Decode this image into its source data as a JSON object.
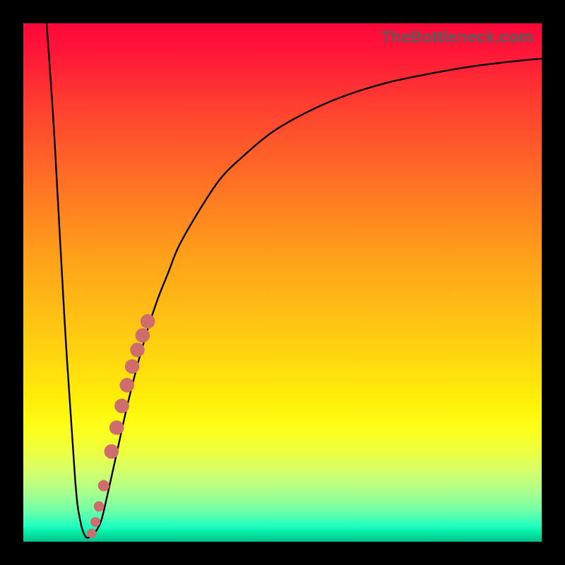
{
  "watermark": "TheBottleneck.com",
  "colors": {
    "frame": "#000000",
    "curve": "#000000",
    "dot_fill": "#cf6d6d",
    "dot_stroke": "#cf6d6d"
  },
  "chart_data": {
    "type": "line",
    "title": "",
    "xlabel": "",
    "ylabel": "",
    "xlim": [
      0,
      100
    ],
    "ylim": [
      0,
      100
    ],
    "grid": false,
    "series": [
      {
        "name": "bottleneck-curve",
        "x": [
          4.5,
          6,
          8,
          10,
          11,
          12,
          13,
          14,
          15,
          16,
          18,
          20,
          22,
          24,
          26,
          28,
          30,
          34,
          38,
          42,
          48,
          55,
          62,
          70,
          78,
          86,
          94,
          100
        ],
        "y": [
          100,
          78,
          42,
          12,
          4,
          1,
          1,
          2,
          4,
          8,
          17,
          26,
          34,
          41,
          47,
          52,
          57,
          64,
          70,
          74,
          79,
          83,
          86,
          88.5,
          90.2,
          91.6,
          92.6,
          93.2
        ]
      }
    ],
    "markers": [
      {
        "name": "band-top",
        "x": 24.0,
        "y": 42.5,
        "r": 1.4
      },
      {
        "name": "band-a",
        "x": 23.0,
        "y": 39.8,
        "r": 1.4
      },
      {
        "name": "band-b",
        "x": 22.0,
        "y": 37.0,
        "r": 1.4
      },
      {
        "name": "band-c",
        "x": 21.0,
        "y": 33.8,
        "r": 1.4
      },
      {
        "name": "band-d",
        "x": 20.0,
        "y": 30.2,
        "r": 1.4
      },
      {
        "name": "band-e",
        "x": 19.0,
        "y": 26.2,
        "r": 1.4
      },
      {
        "name": "band-f",
        "x": 18.0,
        "y": 22.0,
        "r": 1.4
      },
      {
        "name": "band-g",
        "x": 17.0,
        "y": 17.4,
        "r": 1.4
      },
      {
        "name": "dot-1",
        "x": 15.5,
        "y": 10.8,
        "r": 1.1
      },
      {
        "name": "dot-2",
        "x": 14.6,
        "y": 6.8,
        "r": 1.0
      },
      {
        "name": "dot-3",
        "x": 13.9,
        "y": 3.8,
        "r": 0.95
      },
      {
        "name": "dot-bottom",
        "x": 13.2,
        "y": 1.6,
        "r": 0.9
      }
    ]
  }
}
